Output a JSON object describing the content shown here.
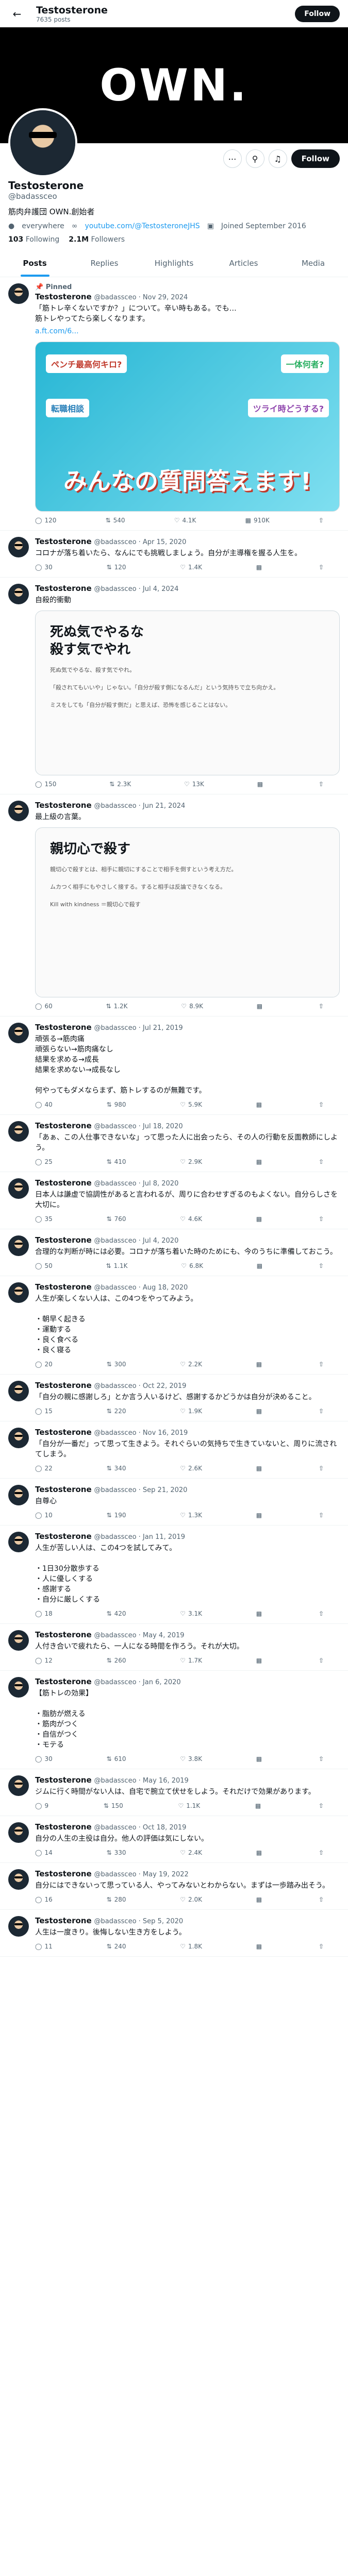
{
  "topbar": {
    "name": "Testosterone",
    "sub": "7635 posts",
    "follow": "Follow"
  },
  "banner": {
    "word": "OWN."
  },
  "profile": {
    "name": "Testosterone",
    "handle": "@badassceo",
    "bio": "筋肉弁護団 OWN.創始者",
    "location": "everywhere",
    "link": "youtube.com/@TestosteroneJHS",
    "joined": "Joined September 2016",
    "following": "103",
    "following_label": "Following",
    "followers": "2.1M",
    "followers_label": "Followers",
    "follow": "Follow"
  },
  "tabs": [
    "Posts",
    "Replies",
    "Highlights",
    "Articles",
    "Media"
  ],
  "icons": {
    "reply": "reply-icon",
    "repost": "repost-icon",
    "like": "like-icon",
    "views": "views-icon"
  },
  "tweets": [
    {
      "pinned": "Pinned",
      "name": "Testosterone",
      "meta": "@badassceo · Nov 29, 2024",
      "text": "「筋トレ辛くないですか？」について。辛い時もある。でも…\n筋トレやってたら楽しくなります。\n",
      "link": "a.ft.com/6...",
      "media": "m1",
      "m1_title": "みんなの質問答えます!",
      "m1_tags": [
        "ペンチ最高何キロ?",
        "一体何者?",
        "転職相談",
        "ツライ時どうする?"
      ],
      "reply": "120",
      "repost": "540",
      "like": "4.1K",
      "views": "910K"
    },
    {
      "name": "Testosterone",
      "meta": "@badassceo · Apr 15, 2020",
      "text": "コロナが落ち着いたら、なんにでも挑戦しましょう。自分が主導権を握る人生を。",
      "reply": "30",
      "repost": "120",
      "like": "1.4K",
      "views": ""
    },
    {
      "name": "Testosterone",
      "meta": "@badassceo · Jul 4, 2024",
      "text": "自殺的衝動",
      "media": "m2",
      "m2_head": "死ぬ気でやるな\n殺す気でやれ",
      "m2_lines": "死ぬ気でやるな、殺す気でやれ。\n\n「殺されてもいいや」じゃない。「自分が殺す側になるんだ」という気持ちで立ち向かえ。\n\nミスをしても「自分が殺す側だ」と思えば、恐怖を感じることはない。",
      "reply": "150",
      "repost": "2.3K",
      "like": "13K",
      "views": ""
    },
    {
      "name": "Testosterone",
      "meta": "@badassceo · Jun 21, 2024",
      "text": "最上級の言葉。",
      "media": "m3",
      "m3_head": "親切心で殺す",
      "m3_lines": "親切心で殺すとは、相手に親切にすることで相手を倒すという考え方だ。\n\nムカつく相手にもやさしく接する。すると相手は反論できなくなる。\n\nKill with kindness ＝親切心で殺す",
      "reply": "60",
      "repost": "1.2K",
      "like": "8.9K",
      "views": ""
    },
    {
      "name": "Testosterone",
      "meta": "@badassceo · Jul 21, 2019",
      "text": "頑張る→筋肉痛\n頑張らない→筋肉痛なし\n結果を求める→成長\n結果を求めない→成長なし\n\n何やってもダメならまず、筋トレするのが無難です。",
      "reply": "40",
      "repost": "980",
      "like": "5.9K",
      "views": ""
    },
    {
      "name": "Testosterone",
      "meta": "@badassceo · Jul 18, 2020",
      "text": "「あぁ、この人仕事できないな」って思った人に出会ったら、その人の行動を反面教師にしよう。",
      "reply": "25",
      "repost": "410",
      "like": "2.9K",
      "views": ""
    },
    {
      "name": "Testosterone",
      "meta": "@badassceo · Jul 8, 2020",
      "text": "日本人は謙虚で協調性があると言われるが、周りに合わせすぎるのもよくない。自分らしさを大切に。",
      "reply": "35",
      "repost": "760",
      "like": "4.6K",
      "views": ""
    },
    {
      "name": "Testosterone",
      "meta": "@badassceo · Jul 4, 2020",
      "text": "合理的な判断が時には必要。コロナが落ち着いた時のためにも、今のうちに準備しておこう。",
      "reply": "50",
      "repost": "1.1K",
      "like": "6.8K",
      "views": ""
    },
    {
      "name": "Testosterone",
      "meta": "@badassceo · Aug 18, 2020",
      "text": "人生が楽しくない人は、この4つをやってみよう。\n\n・朝早く起きる\n・運動する\n・良く食べる\n・良く寝る",
      "reply": "20",
      "repost": "300",
      "like": "2.2K",
      "views": ""
    },
    {
      "name": "Testosterone",
      "meta": "@badassceo · Oct 22, 2019",
      "text": "「自分の親に感謝しろ」とか言う人いるけど、感謝するかどうかは自分が決めること。",
      "reply": "15",
      "repost": "220",
      "like": "1.9K",
      "views": ""
    },
    {
      "name": "Testosterone",
      "meta": "@badassceo · Nov 16, 2019",
      "text": "「自分が一番だ」って思って生きよう。それぐらいの気持ちで生きていないと、周りに流されてしまう。",
      "reply": "22",
      "repost": "340",
      "like": "2.6K",
      "views": ""
    },
    {
      "name": "Testosterone",
      "meta": "@badassceo · Sep 21, 2020",
      "text": "自尊心",
      "reply": "10",
      "repost": "190",
      "like": "1.3K",
      "views": ""
    },
    {
      "name": "Testosterone",
      "meta": "@badassceo · Jan 11, 2019",
      "text": "人生が苦しい人は、この4つを試してみて。\n\n・1日30分散歩する\n・人に優しくする\n・感謝する\n・自分に厳しくする",
      "reply": "18",
      "repost": "420",
      "like": "3.1K",
      "views": ""
    },
    {
      "name": "Testosterone",
      "meta": "@badassceo · May 4, 2019",
      "text": "人付き合いで疲れたら、一人になる時間を作ろう。それが大切。",
      "reply": "12",
      "repost": "260",
      "like": "1.7K",
      "views": ""
    },
    {
      "name": "Testosterone",
      "meta": "@badassceo · Jan 6, 2020",
      "text": "【筋トレの効果】\n\n・脂肪が燃える\n・筋肉がつく\n・自信がつく\n・モテる",
      "reply": "30",
      "repost": "610",
      "like": "3.8K",
      "views": ""
    },
    {
      "name": "Testosterone",
      "meta": "@badassceo · May 16, 2019",
      "text": "ジムに行く時間がない人は、自宅で腕立て伏せをしよう。それだけで効果があります。",
      "reply": "9",
      "repost": "150",
      "like": "1.1K",
      "views": ""
    },
    {
      "name": "Testosterone",
      "meta": "@badassceo · Oct 18, 2019",
      "text": "自分の人生の主役は自分。他人の評価は気にしない。",
      "reply": "14",
      "repost": "330",
      "like": "2.4K",
      "views": ""
    },
    {
      "name": "Testosterone",
      "meta": "@badassceo · May 19, 2022",
      "text": "自分にはできないって思っている人、やってみないとわからない。まずは一歩踏み出そう。",
      "reply": "16",
      "repost": "280",
      "like": "2.0K",
      "views": ""
    },
    {
      "name": "Testosterone",
      "meta": "@badassceo · Sep 5, 2020",
      "text": "人生は一度きり。後悔しない生き方をしよう。",
      "reply": "11",
      "repost": "240",
      "like": "1.8K",
      "views": ""
    }
  ]
}
